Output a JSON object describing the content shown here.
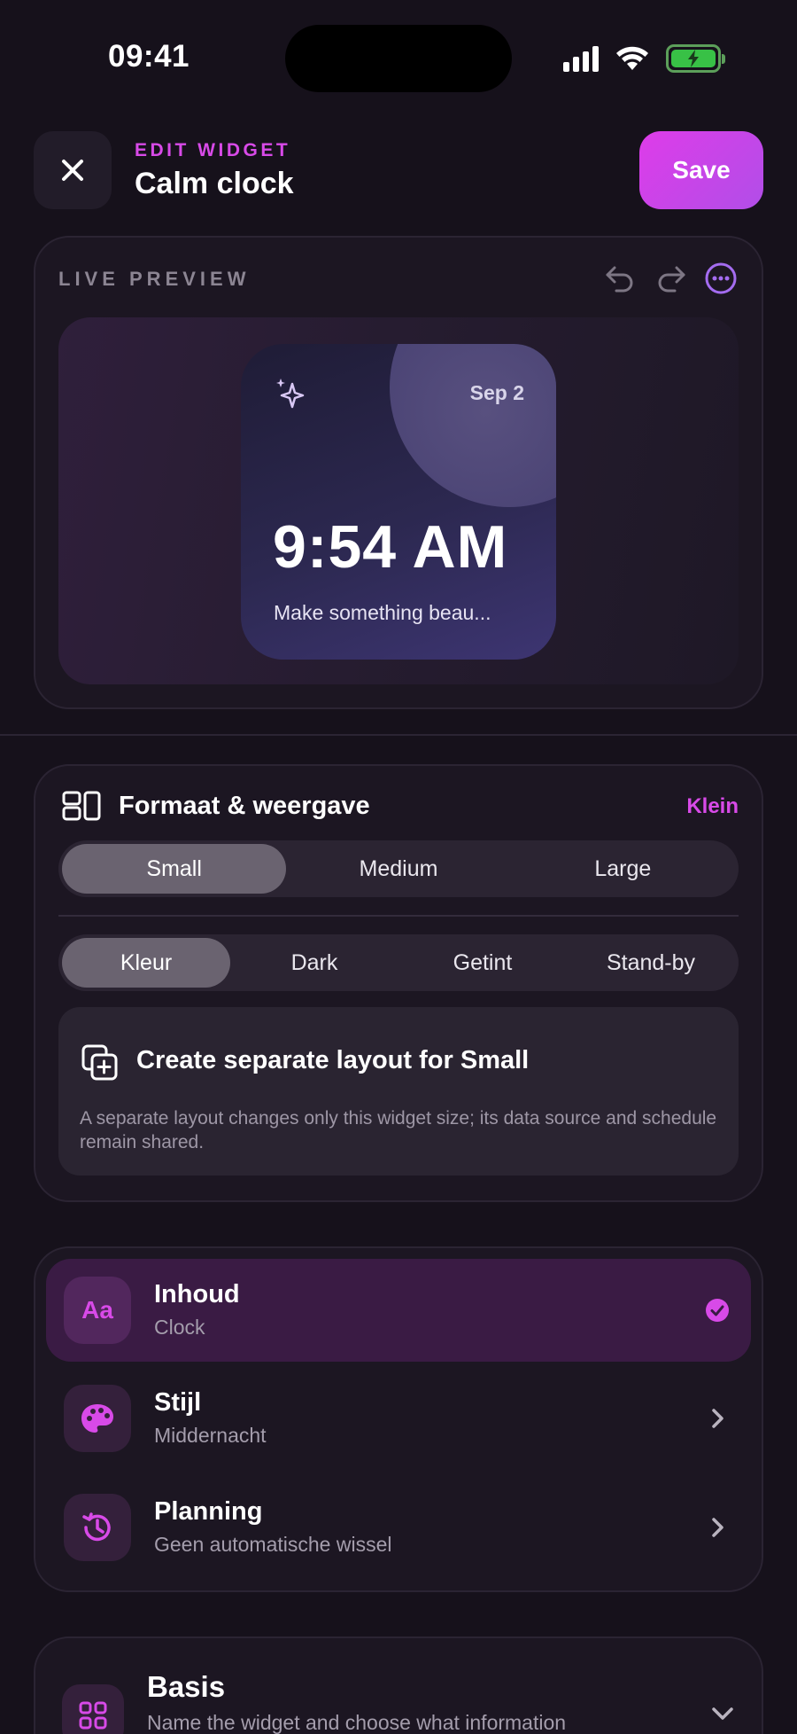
{
  "status_bar": {
    "time": "09:41"
  },
  "header": {
    "kicker": "EDIT WIDGET",
    "title": "Calm clock",
    "save_label": "Save"
  },
  "preview": {
    "label": "LIVE PREVIEW",
    "widget": {
      "date": "Sep 2",
      "time": "9:54 AM",
      "caption": "Make something beau..."
    }
  },
  "format": {
    "title": "Formaat & weergave",
    "current": "Klein",
    "sizes": [
      "Small",
      "Medium",
      "Large"
    ],
    "selected_size": "Small",
    "tones": [
      "Kleur",
      "Dark",
      "Getint",
      "Stand-by"
    ],
    "selected_tone": "Kleur",
    "separate_layout": {
      "title": "Create separate layout for Small",
      "description": "A separate layout changes only this widget size; its data source and schedule remain shared."
    }
  },
  "menu": {
    "items": [
      {
        "label": "Inhoud",
        "sub": "Clock",
        "icon_text": "Aa",
        "icon": "text-icon",
        "active": true
      },
      {
        "label": "Stijl",
        "sub": "Middernacht",
        "icon": "palette-icon",
        "active": false
      },
      {
        "label": "Planning",
        "sub": "Geen automatische wissel",
        "icon": "history-icon",
        "active": false
      }
    ]
  },
  "basis": {
    "title": "Basis",
    "sub": "Name the widget and choose what information"
  },
  "colors": {
    "accent": "#d84ae8",
    "background": "#16111b",
    "card": "#1c1622",
    "active_row": "#3a1b44"
  }
}
